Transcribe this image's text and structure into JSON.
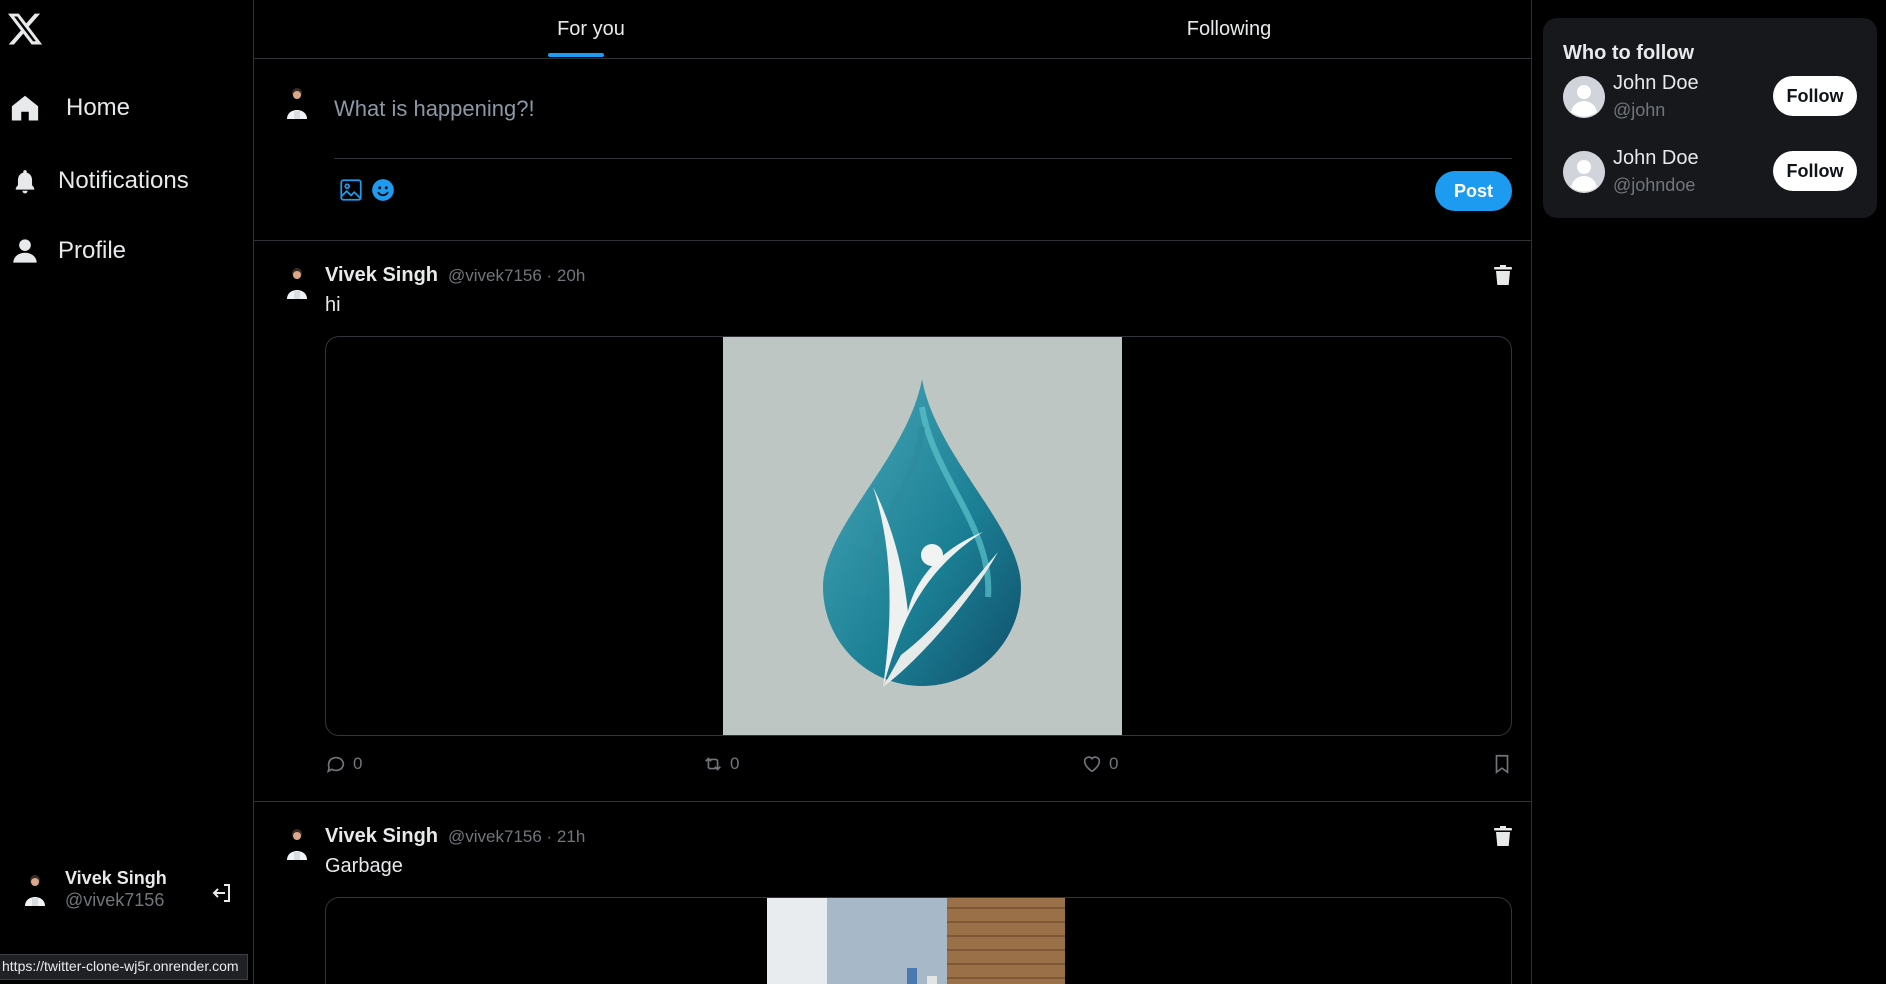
{
  "sidebar": {
    "logo": "x-logo-icon",
    "items": [
      {
        "label": "Home",
        "icon": "home-icon"
      },
      {
        "label": "Notifications",
        "icon": "bell-icon"
      },
      {
        "label": "Profile",
        "icon": "user-icon"
      }
    ],
    "current_user": {
      "name": "Vivek Singh",
      "handle": "@vivek7156"
    },
    "logout_icon": "logout-icon"
  },
  "tabs": [
    {
      "label": "For you",
      "active": true
    },
    {
      "label": "Following",
      "active": false
    }
  ],
  "composer": {
    "placeholder": "What is happening?!",
    "post_label": "Post"
  },
  "posts": [
    {
      "name": "Vivek Singh",
      "meta": "@vivek7156 · 20h",
      "text": "hi",
      "replies": "0",
      "reposts": "0",
      "likes": "0"
    },
    {
      "name": "Vivek Singh",
      "meta": "@vivek7156 · 21h",
      "text": "Garbage"
    }
  ],
  "who_to_follow": {
    "title": "Who to follow",
    "users": [
      {
        "name": "John Doe",
        "handle": "@john",
        "button": "Follow"
      },
      {
        "name": "John Doe",
        "handle": "@johndoe",
        "button": "Follow"
      }
    ]
  },
  "status_url": "https://twitter-clone-wj5r.onrender.com",
  "colors": {
    "background": "#000000",
    "accent": "#1d9bf0",
    "border": "#2f3336",
    "muted": "#71767b",
    "card": "#16181c"
  }
}
